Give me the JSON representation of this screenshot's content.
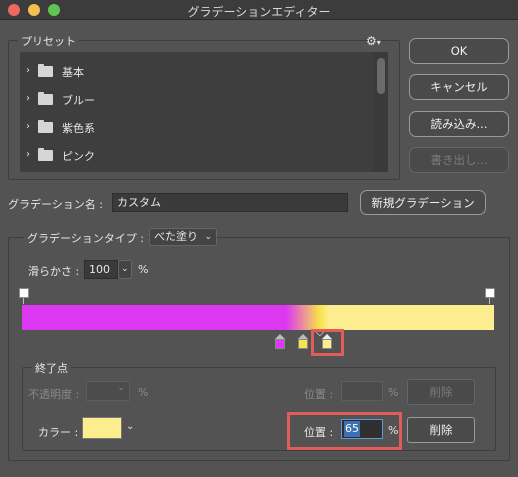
{
  "window": {
    "title": "グラデーションエディター",
    "traffic_lights": {
      "close": "#ec6a5e",
      "minimize": "#f4bf4f",
      "zoom": "#61c554"
    }
  },
  "presets": {
    "label": "プリセット",
    "gear_icon": "gear-icon",
    "items": [
      {
        "label": "基本"
      },
      {
        "label": "ブルー"
      },
      {
        "label": "紫色系"
      },
      {
        "label": "ピンク"
      }
    ]
  },
  "buttons": {
    "ok": "OK",
    "cancel": "キャンセル",
    "load": "読み込み...",
    "export": "書き出し...",
    "new_gradient": "新規グラデーション"
  },
  "name": {
    "label": "グラデーション名 :",
    "value": "カスタム"
  },
  "gradient_type": {
    "label": "グラデーションタイプ :",
    "value": "べた塗り"
  },
  "smoothness": {
    "label": "滑らかさ :",
    "value": "100",
    "unit": "%"
  },
  "gradient": {
    "colors": {
      "start": "#dc38f2",
      "mid": "#f7e34a",
      "end": "#fcee8e"
    }
  },
  "color_stops_group": {
    "label": "終了点",
    "opacity_label": "不透明度 :",
    "opacity_unit": "%",
    "opacity_position_label": "位置 :",
    "opacity_position_unit": "%",
    "opacity_delete": "削除",
    "color_label": "カラー :",
    "color_swatch": "#fcee8e",
    "position_label": "位置 :",
    "position_value": "65",
    "position_unit": "%",
    "delete": "削除"
  }
}
